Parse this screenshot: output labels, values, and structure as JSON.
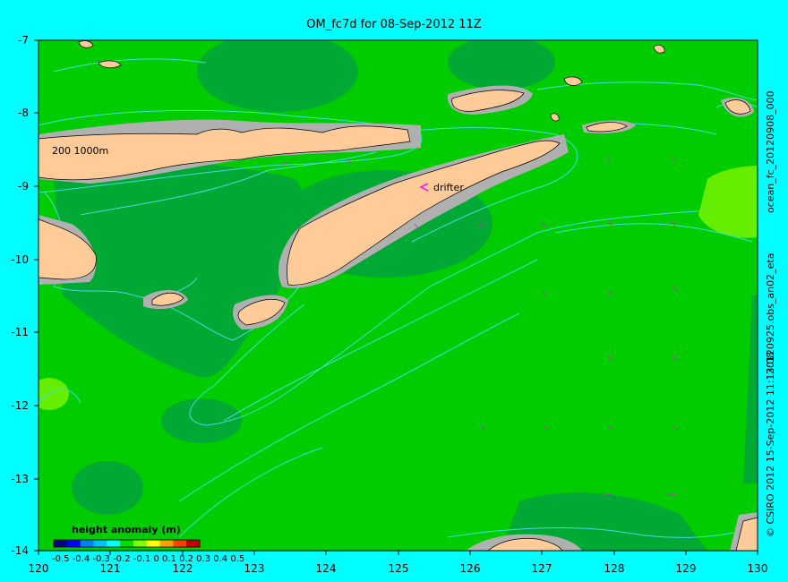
{
  "title": "OM_fc7d for 08-Sep-2012 11Z",
  "map": {
    "lon_ticks": [
      "120",
      "121",
      "122",
      "123",
      "124",
      "125",
      "126",
      "127",
      "128",
      "129",
      "130"
    ],
    "lat_ticks": [
      "-7",
      "-8",
      "-9",
      "-10",
      "-11",
      "-12",
      "-13",
      "-14"
    ],
    "depth_contours_label": "200  1000m",
    "drifter_label": "drifter"
  },
  "side_labels": {
    "top": "ocean_fc_20120908_000",
    "mid": "20120925.obs_an02_eta",
    "bottom": "© CSIRO 2012   15-Sep-2012 11:13:08"
  },
  "colorbar": {
    "title": "height anomaly  (m)",
    "labels": "-0.5 -0.4 -0.3 -0.2 -0.1  0  0.1 0.2 0.3 0.4 0.5",
    "colors": [
      "#000080",
      "#0000ff",
      "#0080ff",
      "#00c0ff",
      "#00ffff",
      "#00e000",
      "#80ff00",
      "#ffff00",
      "#ffa000",
      "#ff4000",
      "#c00000"
    ]
  },
  "colors": {
    "ocean": "#00cc00",
    "ocean_dark": "#00aa33",
    "land": "#ffcc99",
    "shelf": "#b0b0b0",
    "contour": "#44dddd",
    "drifter": "#ff00ff",
    "frame_bg": "#00ffff"
  }
}
